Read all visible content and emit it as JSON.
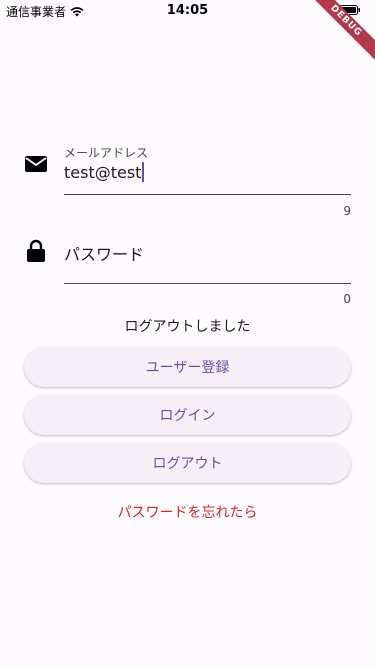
{
  "status_bar": {
    "carrier": "通信事業者",
    "time": "14:05",
    "debug_label": "DEBUG"
  },
  "email_field": {
    "label": "メールアドレス",
    "value": "test@test",
    "counter": "9",
    "icon": "envelope-icon"
  },
  "password_field": {
    "placeholder": "パスワード",
    "counter": "0",
    "icon": "lock-icon"
  },
  "status_message": "ログアウトしました",
  "buttons": {
    "register": "ユーザー登録",
    "login": "ログイン",
    "logout": "ログアウト"
  },
  "forgot_password": "パスワードを忘れたら",
  "colors": {
    "primary": "#6750a4",
    "error": "#e02424",
    "background": "#fefbff",
    "button_bg": "#f5f0f8",
    "debug_ribbon": "#b3394a"
  }
}
